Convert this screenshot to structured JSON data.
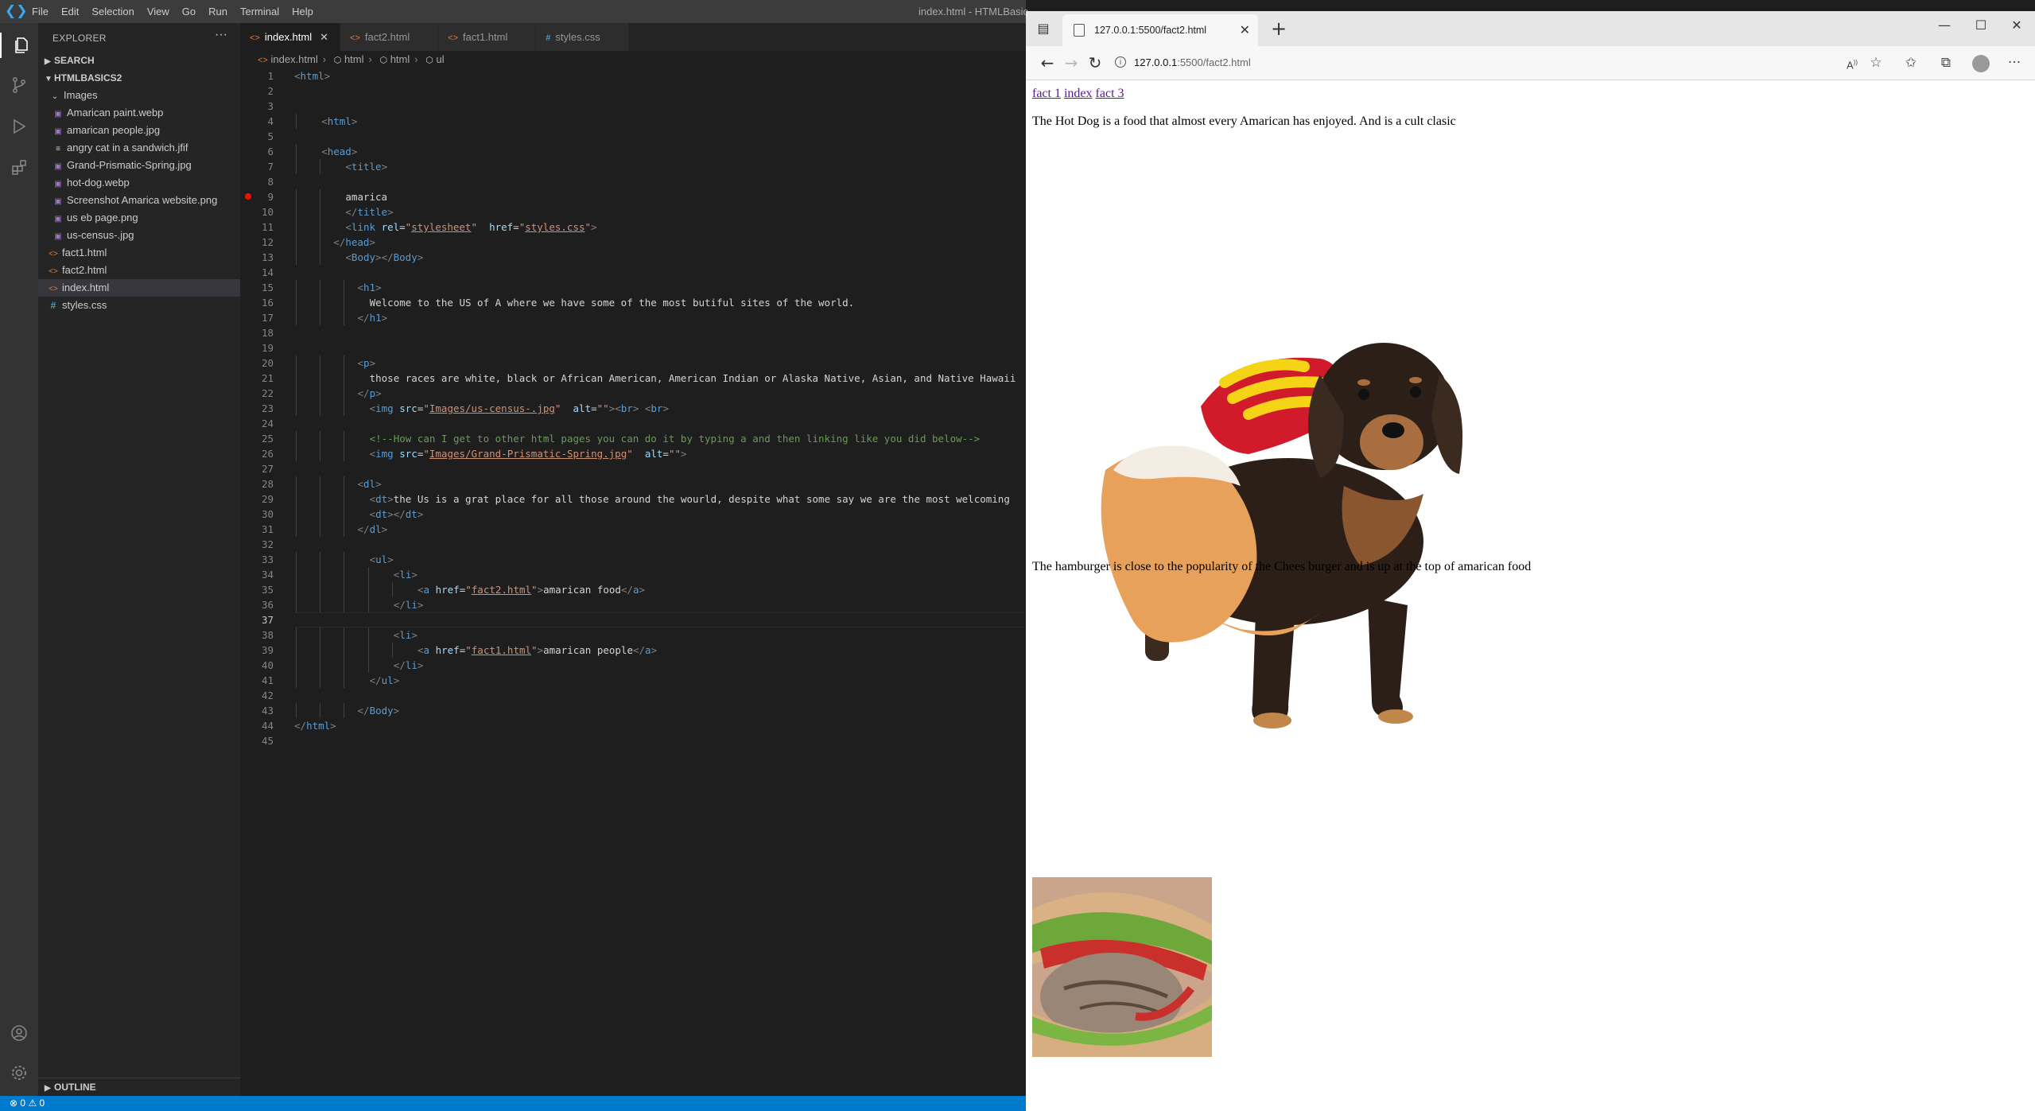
{
  "vscode": {
    "menu": [
      "File",
      "Edit",
      "Selection",
      "View",
      "Go",
      "Run",
      "Terminal",
      "Help"
    ],
    "window_title": "index.html - HTMLBasic",
    "explorer": {
      "header": "EXPLORER",
      "search_section": "SEARCH",
      "project": "HTMLBASICS2",
      "tree": [
        {
          "label": "Images",
          "type": "folder"
        },
        {
          "label": "Amarican paint.webp",
          "type": "img"
        },
        {
          "label": "amarican people.jpg",
          "type": "img"
        },
        {
          "label": "angry cat in a sandwich.jfif",
          "type": "file"
        },
        {
          "label": "Grand-Prismatic-Spring.jpg",
          "type": "img"
        },
        {
          "label": "hot-dog.webp",
          "type": "img"
        },
        {
          "label": "Screenshot Amarica website.png",
          "type": "img"
        },
        {
          "label": "us eb page.png",
          "type": "img"
        },
        {
          "label": "us-census-.jpg",
          "type": "img"
        },
        {
          "label": "fact1.html",
          "type": "html"
        },
        {
          "label": "fact2.html",
          "type": "html"
        },
        {
          "label": "index.html",
          "type": "html",
          "selected": true
        },
        {
          "label": "styles.css",
          "type": "css"
        }
      ],
      "outline_section": "OUTLINE"
    },
    "tabs": [
      {
        "label": "index.html",
        "icon": "html-icon",
        "active": true
      },
      {
        "label": "fact2.html",
        "icon": "html-icon",
        "active": false
      },
      {
        "label": "fact1.html",
        "icon": "html-icon",
        "active": false
      },
      {
        "label": "styles.css",
        "icon": "css-icon",
        "active": false
      }
    ],
    "breadcrumb": [
      "index.html",
      "html",
      "html",
      "ul"
    ],
    "code_lines": [
      "<html>",
      "",
      "",
      "<html>",
      "",
      "<head>",
      "<title>",
      "",
      "amarica",
      "</title>",
      "<link rel=\"stylesheet\" href=\"styles.css\">",
      "</head>",
      "<Body></Body>",
      "",
      "<h1>",
      "Welcome to the US of A where we have some of the most butiful sites of the world.",
      "</h1>",
      "",
      "",
      "<p>",
      "those races are white, black or African American, American Indian or Alaska Native, Asian, and Native Hawaii",
      "</p>",
      "<img src=\"Images/us-census-.jpg\" alt=\"\"><br> <br>",
      "",
      "<!--How can I get to other html pages you can do it by typing a and then linking like you did below-->",
      "<img src=\"Images/Grand-Prismatic-Spring.jpg\" alt=\"\">",
      "",
      "<dl>",
      "<dt>the Us is a grat place for all those around the wourld, despite what some say we are the most welcoming",
      "<dt></dt>",
      "</dl>",
      "",
      "<ul>",
      "<li>",
      "<a href=\"fact2.html\">amarican food</a>",
      "</li>",
      "",
      "<li>",
      "<a href=\"fact1.html\">amarican people</a>",
      "</li>",
      "</ul>",
      "",
      "</Body>",
      "</html>",
      ""
    ],
    "current_line": 37,
    "breakpoint_line": 9,
    "status": {
      "errors": "0",
      "warnings": "0"
    },
    "colors": {
      "accent": "#007acc",
      "tag": "#569cd6",
      "attr": "#9cdcfe",
      "string": "#ce9178",
      "comment": "#6a9955"
    }
  },
  "browser": {
    "tab_title": "127.0.0.1:5500/fact2.html",
    "url_host": "127.0.0.1",
    "url_rest": ":5500/fact2.html",
    "page": {
      "links": [
        "fact 1",
        "index",
        "fact 3"
      ],
      "hotdog_text": "The Hot Dog is a food that almost every Amarican has enjoyed. And is a cult clasic",
      "hamburger_text": "The hamburger is close to the popularity of the Chees burger and is up at the top of amarican food"
    }
  }
}
